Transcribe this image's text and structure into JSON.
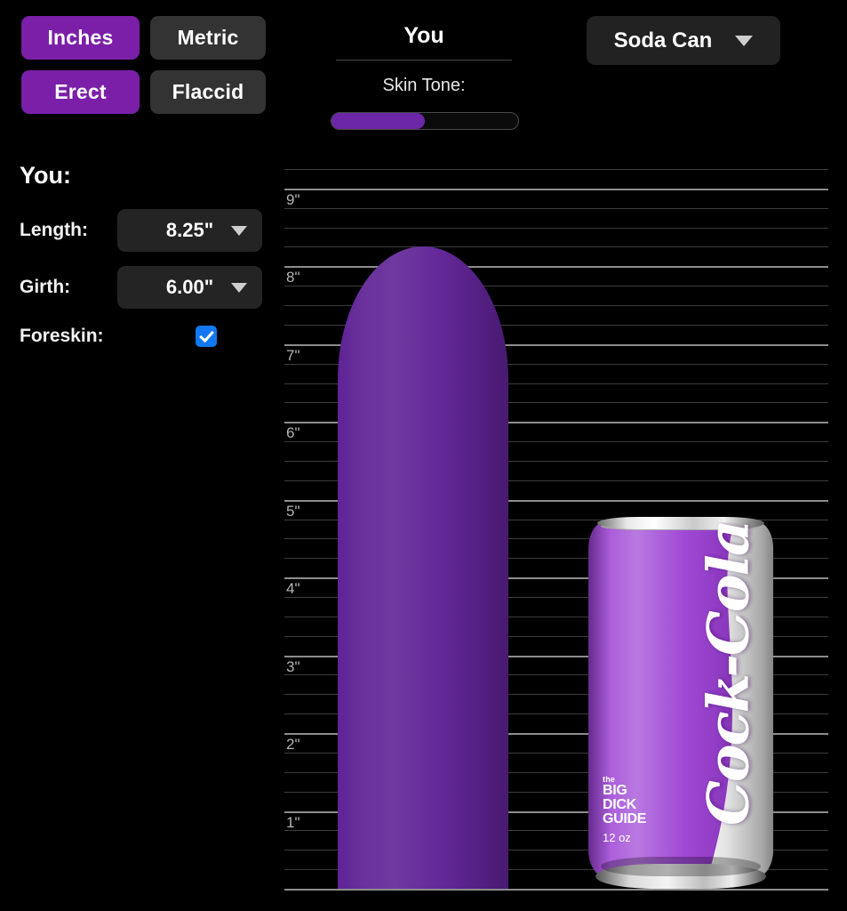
{
  "units": {
    "options": [
      {
        "label": "Inches",
        "active": true
      },
      {
        "label": "Metric",
        "active": false
      }
    ]
  },
  "state": {
    "options": [
      {
        "label": "Erect",
        "active": true
      },
      {
        "label": "Flaccid",
        "active": false
      }
    ]
  },
  "you_header": {
    "title": "You",
    "skin_tone_label": "Skin Tone:",
    "skin_tone_percent": 50
  },
  "compare": {
    "selected": "Soda Can",
    "caret_icon": "chevron-down-icon"
  },
  "panel": {
    "title": "You:",
    "fields": [
      {
        "label": "Length:",
        "value": "8.25\"",
        "caret_icon": "chevron-down-icon"
      },
      {
        "label": "Girth:",
        "value": "6.00\"",
        "caret_icon": "chevron-down-icon"
      }
    ],
    "foreskin": {
      "label": "Foreskin:",
      "checked": true,
      "icon": "check-icon"
    }
  },
  "chart_data": {
    "type": "bar",
    "title": "",
    "xlabel": "",
    "ylabel": "inches",
    "ylim": [
      0,
      9.25
    ],
    "grid": true,
    "major_tick_interval": 1,
    "minor_tick_interval": 0.25,
    "tick_labels": [
      "1\"",
      "2\"",
      "3\"",
      "4\"",
      "5\"",
      "6\"",
      "7\"",
      "8\"",
      "9\""
    ],
    "tick_values": [
      1,
      2,
      3,
      4,
      5,
      6,
      7,
      8,
      9
    ],
    "categories": [
      "You",
      "Soda Can"
    ],
    "values": [
      8.25,
      4.83
    ],
    "series": [
      {
        "name": "You",
        "value_in": 8.25,
        "girth_in": 6.0,
        "color": "#5F2395"
      },
      {
        "name": "Soda Can",
        "value_in": 4.83,
        "color": "#9B3FD4"
      }
    ]
  },
  "can": {
    "wordmark": "Cock-Cola",
    "brand_line1": "the",
    "brand_line2": "BIG",
    "brand_line3": "DICK",
    "brand_line4": "GUIDE",
    "volume": "12 oz"
  },
  "colors": {
    "accent_purple": "#7B1FA8",
    "shaft_purple": "#5F2395",
    "can_purple": "#9B3FD4",
    "inactive_button": "#333333",
    "checkbox_blue": "#1277F2",
    "background": "#000000"
  }
}
